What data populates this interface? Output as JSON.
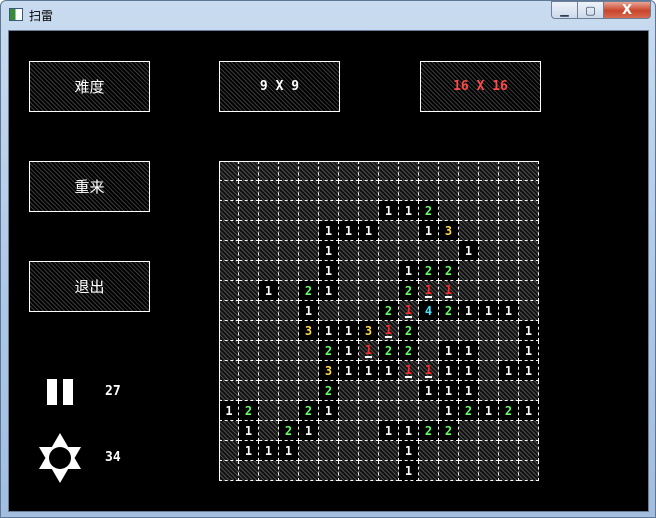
{
  "window": {
    "title": "扫雷",
    "buttons": {
      "minimize": "▁",
      "maximize": "▢",
      "close": "X"
    }
  },
  "menu": {
    "difficulty_label": "难度",
    "restart_label": "重来",
    "exit_label": "退出",
    "size_9_label": "9 X 9",
    "size_16_label": "16 X 16"
  },
  "status": {
    "time_value": "27",
    "mines_value": "34"
  },
  "colors": {
    "one": "#ffffff",
    "two": "#66ff66",
    "three": "#ffd84a",
    "four": "#44e5ff",
    "flag": "#ff2a2a",
    "selected_size": "#ff4a4a"
  },
  "board": {
    "rows": 16,
    "cols": 16,
    "grid": [
      "################",
      "################",
      "########112#####",
      "#####111##13####",
      "#####1######1###",
      "#####1###122####",
      "##1#21###2FF####",
      "####1###2F42111#",
      "####3113F2#####1",
      "#####21F22#11##1",
      "#####3111FF11#11",
      "#####2####111###",
      "12##21#####12121",
      "#1#21###1122####",
      "#111#####1######",
      "#########1######"
    ]
  }
}
